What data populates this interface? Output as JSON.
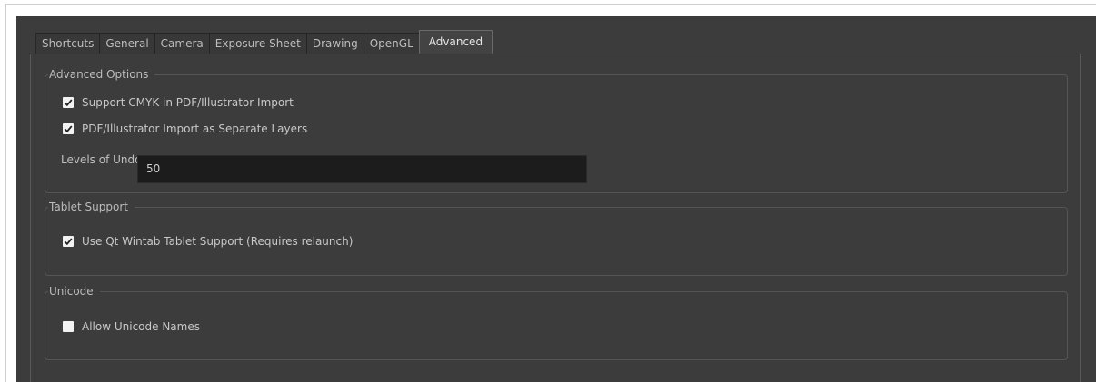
{
  "tabs": [
    {
      "label": "Shortcuts"
    },
    {
      "label": "General"
    },
    {
      "label": "Camera"
    },
    {
      "label": "Exposure Sheet"
    },
    {
      "label": "Drawing"
    },
    {
      "label": "OpenGL"
    },
    {
      "label": "Advanced",
      "active": true
    }
  ],
  "advanced_options": {
    "title": "Advanced Options",
    "support_cmyk": {
      "label": "Support CMYK in PDF/Illustrator Import",
      "checked": true
    },
    "separate_layers": {
      "label": "PDF/Illustrator Import as Separate Layers",
      "checked": true
    },
    "levels_of_undo": {
      "label": "Levels of Undo",
      "value": "50"
    }
  },
  "tablet_support": {
    "title": "Tablet Support",
    "qt_wintab": {
      "label": "Use Qt Wintab Tablet Support (Requires relaunch)",
      "checked": true
    }
  },
  "unicode": {
    "title": "Unicode",
    "allow_unicode": {
      "label": "Allow Unicode Names",
      "checked": false
    }
  },
  "colors": {
    "dialog_bg": "#3c3c3c",
    "input_bg": "#1c1c1c",
    "checkbox_bg": "#f2f2f2"
  }
}
